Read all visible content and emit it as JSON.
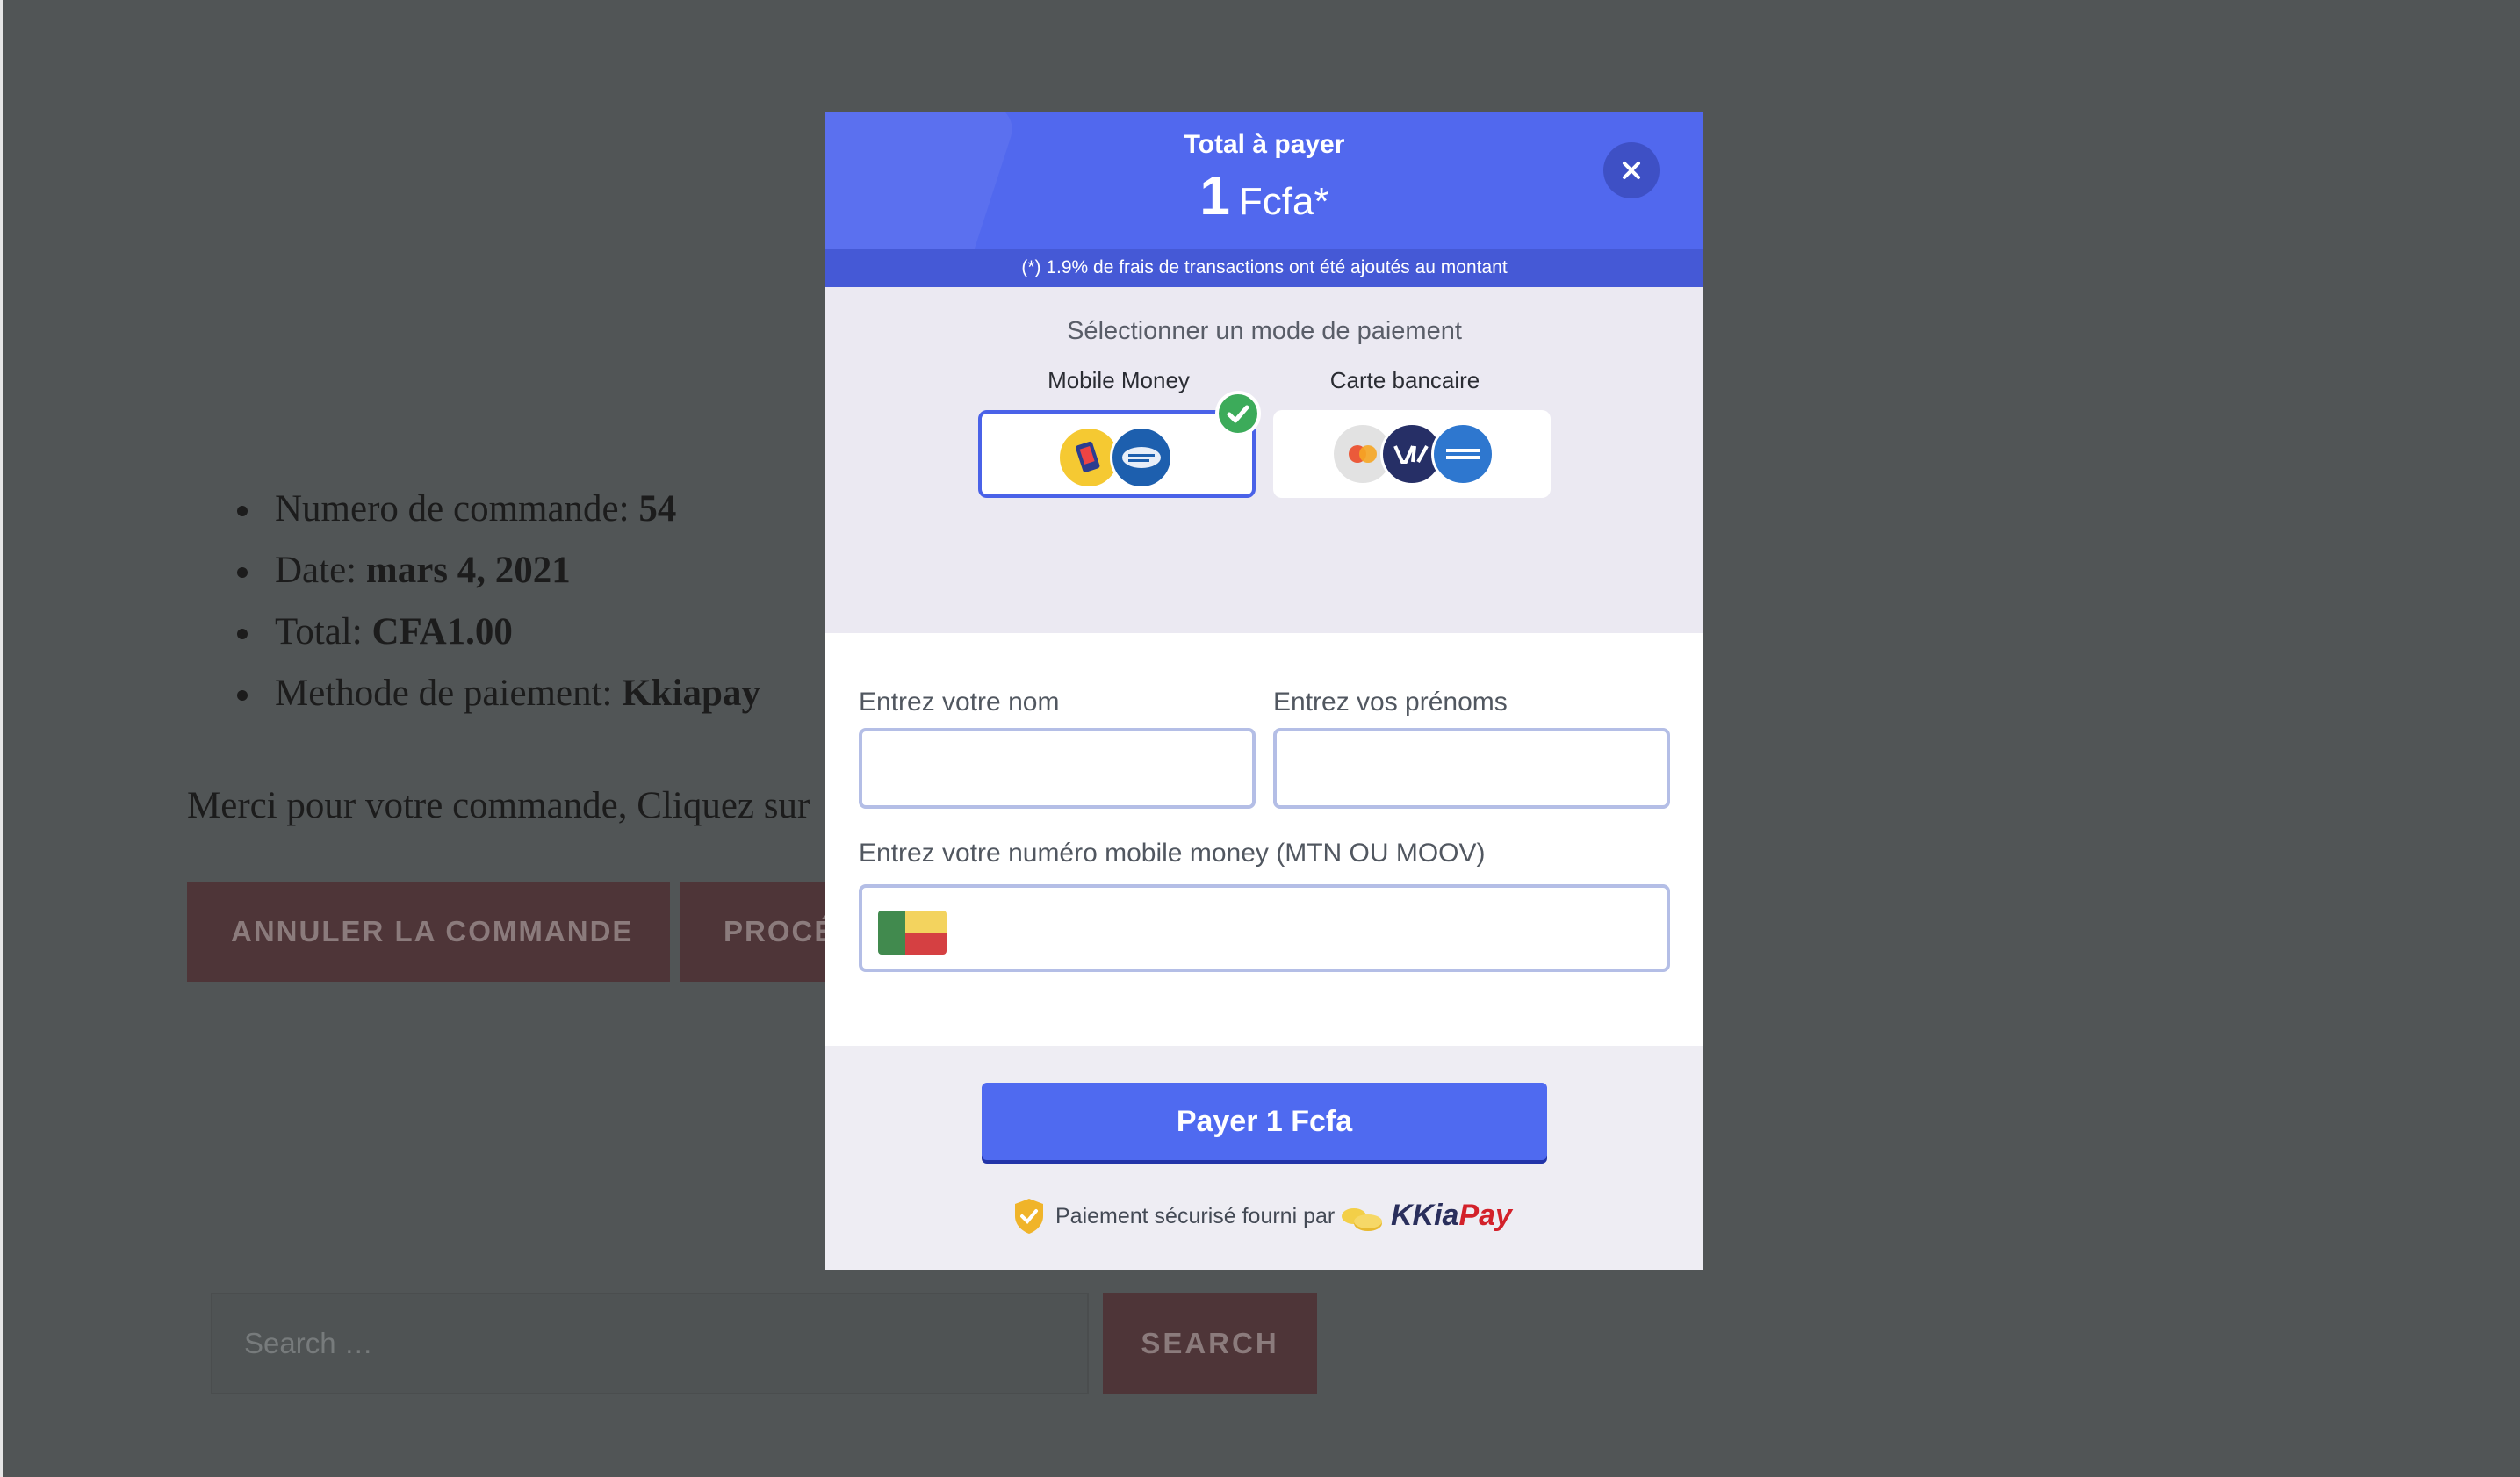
{
  "order": {
    "details": [
      {
        "label": "Numero de commande: ",
        "value": "54"
      },
      {
        "label": "Date: ",
        "value": "mars 4, 2021"
      },
      {
        "label": "Total: ",
        "value": "CFA1.00"
      },
      {
        "label": "Methode de paiement: ",
        "value": "Kkiapay"
      }
    ],
    "thanks_text": "Merci pour votre commande, Cliquez sur l",
    "cancel_label": "ANNULER LA COMMANDE",
    "proceed_label": "PROCÉ"
  },
  "search": {
    "placeholder": "Search …",
    "button_label": "SEARCH"
  },
  "modal": {
    "title": "Total à payer",
    "amount": "1",
    "currency": "Fcfa*",
    "fee_note": "(*) 1.9% de frais de transactions ont été ajoutés au montant",
    "method_title": "Sélectionner un mode de paiement",
    "methods": [
      {
        "label": "Mobile Money",
        "selected": true
      },
      {
        "label": "Carte bancaire",
        "selected": false
      }
    ],
    "name_label": "Entrez votre nom",
    "firstname_label": "Entrez vos prénoms",
    "phone_label": "Entrez votre numéro mobile money (MTN OU MOOV)",
    "pay_label": "Payer 1 Fcfa",
    "secure_text": "Paiement sécurisé fourni par",
    "brand_kkia": "KKia",
    "brand_pay": "Pay",
    "colors": {
      "primary": "#5168ee",
      "check": "#3cab5a",
      "brand_red": "#d3212a"
    }
  }
}
